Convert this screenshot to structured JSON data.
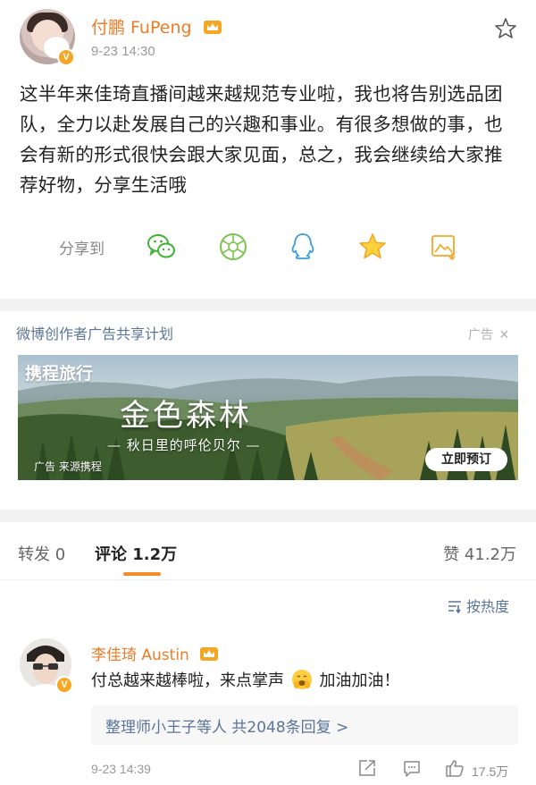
{
  "post": {
    "username": "付鹏 FuPeng",
    "timestamp": "9-23 14:30",
    "text": "这半年来佳琦直播间越来越规范专业啦，我也将告别选品团队，全力以赴发展自己的兴趣和事业。有很多想做的事，也会有新的形式很快会跟大家见面，总之，我会继续给大家推荐好物，分享生活哦",
    "share_label": "分享到",
    "share_icons": [
      "wechat-icon",
      "moments-icon",
      "qq-icon",
      "qzone-icon",
      "image-icon"
    ]
  },
  "ad": {
    "program_title": "微博创作者广告共享计划",
    "tag": "广告",
    "brand": "携程旅行",
    "headline": "金色森林",
    "subline": "— 秋日里的呼伦贝尔 —",
    "source": "广告 来源携程",
    "cta": "立即预订"
  },
  "tabs": {
    "repost": "转发 0",
    "comments": "评论 1.2万",
    "likes": "赞 41.2万"
  },
  "sort": {
    "label": "按热度"
  },
  "comment": {
    "username": "李佳琦 Austin",
    "text_before": "付总越来越棒啦，来点掌声",
    "text_after": "加油加油！",
    "replies": "整理师小王子等人 共2048条回复 >",
    "timestamp": "9-23 14:39",
    "likes": "17.5万"
  },
  "colors": {
    "accent_orange": "#f07b24",
    "link_blue": "#5a7597",
    "tab_underline": "#f48c2a",
    "verified_badge": "#f5a623"
  }
}
